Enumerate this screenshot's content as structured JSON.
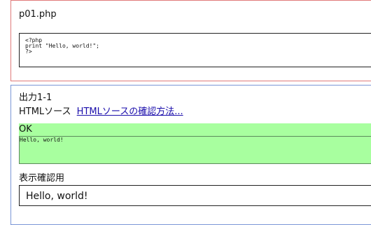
{
  "file_panel": {
    "filename": "p01.php",
    "code_lines": [
      "<?php",
      "print \"Hello, world!\";",
      "?>"
    ]
  },
  "output_panel": {
    "title": "出力1-1",
    "source_label": "HTMLソース",
    "source_link": "HTMLソースの確認方法...",
    "status": "OK",
    "output_text": "Hello, world!",
    "preview_label": "表示確認用",
    "preview_text": "Hello, world!"
  },
  "colors": {
    "file_border": "#e07a7a",
    "output_border": "#7a96d6",
    "ok_green": "#a8ff9f",
    "link_blue": "#1a0dab"
  }
}
